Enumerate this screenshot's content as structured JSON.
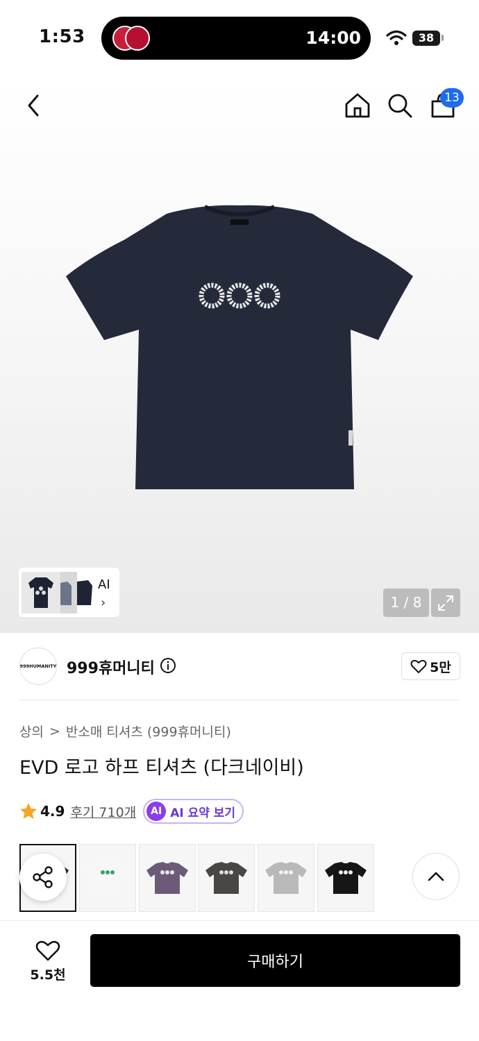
{
  "status_bar": {
    "time": "1:53",
    "island_time": "14:00",
    "battery": "38"
  },
  "nav": {
    "cart_count": "13"
  },
  "gallery": {
    "ai_label": "AI",
    "ai_chevron": "›",
    "page": "1 / 8"
  },
  "brand": {
    "logo_text": "999HUMANITY",
    "name": "999휴머니티",
    "likes": "5만"
  },
  "breadcrumb": {
    "category": "상의",
    "separator": ">",
    "subcategory": "반소매 티셔츠 (999휴머니티)"
  },
  "product": {
    "title": "EVD 로고 하프 티셔츠 (다크네이비)",
    "rating": "4.9",
    "reviews": "후기 710개",
    "ai_badge": "AI",
    "ai_summary": "AI 요약 보기"
  },
  "color_options": [
    {
      "name": "dark-navy",
      "shirt": "#1f2330",
      "logo": "#eeeeee"
    },
    {
      "name": "white",
      "shirt": "#f7f7f7",
      "logo": "#3aa36a"
    },
    {
      "name": "purple",
      "shirt": "#6b5a78",
      "logo": "#e8e8e8"
    },
    {
      "name": "charcoal",
      "shirt": "#4a4644",
      "logo": "#dddddd"
    },
    {
      "name": "grey",
      "shirt": "#b9b9b9",
      "logo": "#f2f2f2"
    },
    {
      "name": "black",
      "shirt": "#161616",
      "logo": "#eeeeee"
    }
  ],
  "bottom_bar": {
    "wish_count": "5.5천",
    "buy_label": "구매하기"
  },
  "colors": {
    "brand_blue": "#1d6bf0",
    "ai_purple": "#8a3ee8",
    "star": "#f5a623"
  }
}
